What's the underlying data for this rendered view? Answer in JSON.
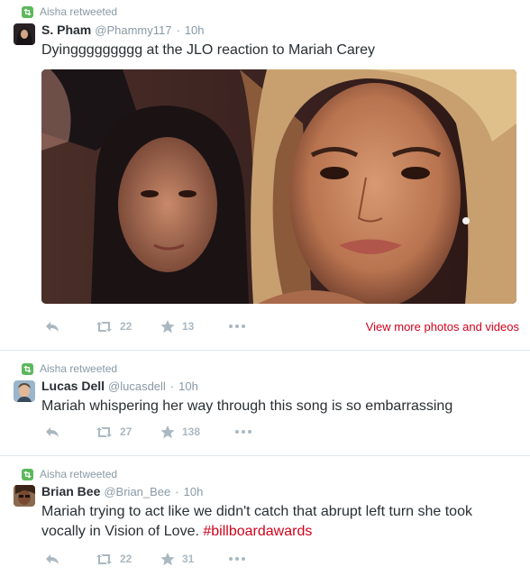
{
  "tweets": [
    {
      "context": "Aisha retweeted",
      "fullname": "S. Pham",
      "username": "@Phammy117",
      "time": "10h",
      "text": "Dyinggggggggg at the JLO reaction to Mariah Carey",
      "hashtag": "",
      "retweets": "22",
      "favorites": "13",
      "media_link": "View more photos and videos",
      "avatar_color": "#1c1a1c"
    },
    {
      "context": "Aisha retweeted",
      "fullname": "Lucas Dell",
      "username": "@lucasdell",
      "time": "10h",
      "text": "Mariah whispering her way through this song is so embarrassing",
      "hashtag": "",
      "retweets": "27",
      "favorites": "138",
      "avatar_color": "#6c8ba8"
    },
    {
      "context": "Aisha retweeted",
      "fullname": "Brian Bee",
      "username": "@Brian_Bee",
      "time": "10h",
      "text": "Mariah trying to act like we didn't catch that abrupt left turn she took vocally in Vision of Love.",
      "hashtag": "#billboardawards",
      "retweets": "22",
      "favorites": "31",
      "avatar_color": "#6b4a36"
    }
  ],
  "colors": {
    "accent": "#d0021b",
    "muted": "#8899a6",
    "icon": "#aab8c2",
    "retweet_badge": "#5cb85c"
  },
  "icons": [
    "retweet-badge-icon",
    "reply-icon",
    "retweet-icon",
    "star-icon",
    "more-icon"
  ]
}
